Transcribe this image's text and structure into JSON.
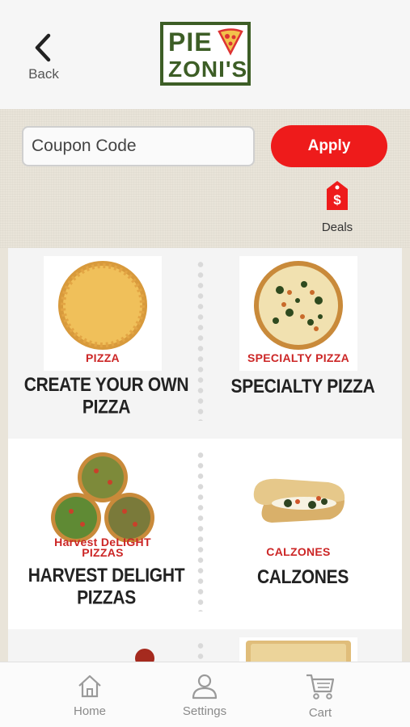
{
  "header": {
    "back_label": "Back",
    "logo_line1": "PIE",
    "logo_line2": "ZONI'S"
  },
  "coupon": {
    "placeholder": "Coupon Code",
    "apply_label": "Apply"
  },
  "deals": {
    "label": "Deals",
    "icon": "price-tag-icon",
    "icon_symbol": "$"
  },
  "menu": {
    "items": [
      {
        "thumb_label": "PIZZA",
        "title": "CREATE YOUR OWN PIZZA"
      },
      {
        "thumb_label": "SPECIALTY PIZZA",
        "title": "SPECIALTY PIZZA"
      },
      {
        "thumb_label_line1": "Harvest DeLIGHT",
        "thumb_label_line2": "PIZZAS",
        "title": "HARVEST DELIGHT PIZZAS"
      },
      {
        "thumb_label": "CALZONES",
        "title": "CALZONES"
      }
    ]
  },
  "tabbar": {
    "tabs": [
      {
        "label": "Home",
        "icon": "home-icon"
      },
      {
        "label": "Settings",
        "icon": "user-icon"
      },
      {
        "label": "Cart",
        "icon": "cart-icon"
      }
    ]
  },
  "colors": {
    "accent": "#ee1b1b",
    "logo_green": "#3d5e26",
    "label_red": "#cc2626"
  }
}
